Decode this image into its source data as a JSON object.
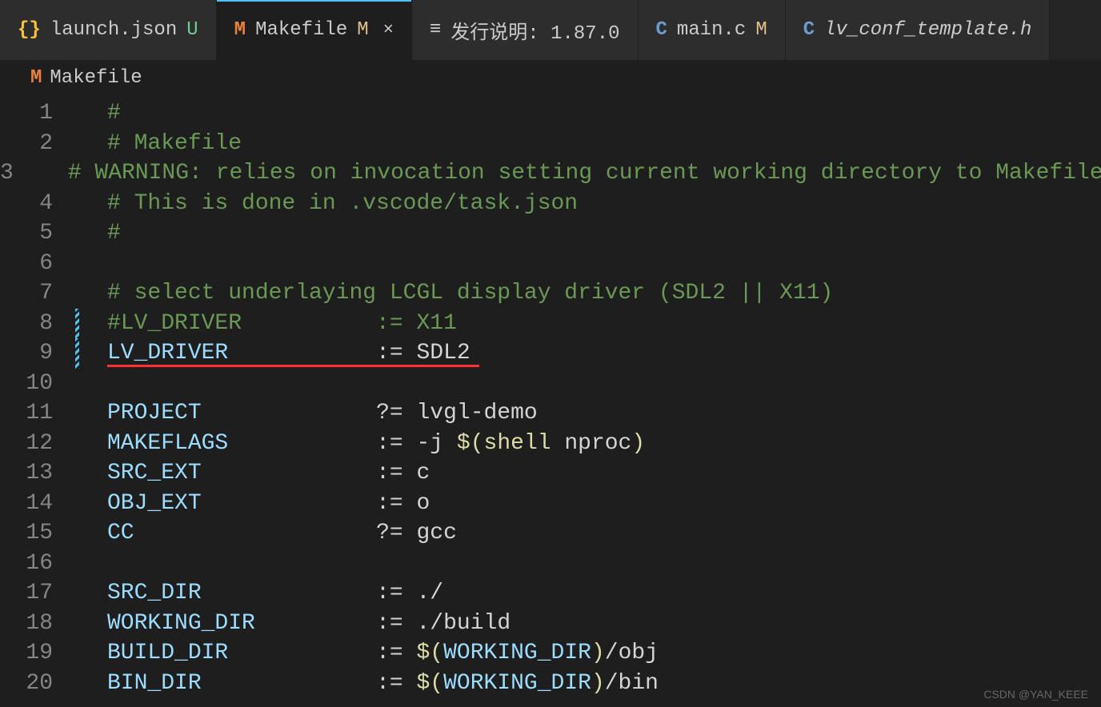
{
  "tabs": [
    {
      "icon": "{}",
      "iconClass": "icon-json",
      "label": "launch.json",
      "status": "U",
      "statusClass": "status-untracked",
      "active": false,
      "italic": false,
      "close": false
    },
    {
      "icon": "M",
      "iconClass": "icon-makefile",
      "label": "Makefile",
      "status": "M",
      "statusClass": "status-modified",
      "active": true,
      "italic": false,
      "close": true
    },
    {
      "icon": "≡",
      "iconClass": "icon-notes",
      "label": "发行说明: 1.87.0",
      "status": "",
      "statusClass": "",
      "active": false,
      "italic": false,
      "close": false
    },
    {
      "icon": "C",
      "iconClass": "icon-c",
      "label": "main.c",
      "status": "M",
      "statusClass": "status-modified",
      "active": false,
      "italic": false,
      "close": false
    },
    {
      "icon": "C",
      "iconClass": "icon-c",
      "label": "lv_conf_template.h",
      "status": "",
      "statusClass": "",
      "active": false,
      "italic": true,
      "close": false
    }
  ],
  "breadcrumb": {
    "icon": "M",
    "label": "Makefile"
  },
  "code": {
    "lines": [
      {
        "n": 1,
        "marker": "",
        "tokens": [
          {
            "c": "tok-comment",
            "t": "#"
          }
        ]
      },
      {
        "n": 2,
        "marker": "",
        "tokens": [
          {
            "c": "tok-comment",
            "t": "# Makefile"
          }
        ]
      },
      {
        "n": 3,
        "marker": "",
        "tokens": [
          {
            "c": "tok-comment",
            "t": "# WARNING: relies on invocation setting current working directory to Makefile lo"
          }
        ]
      },
      {
        "n": 4,
        "marker": "",
        "tokens": [
          {
            "c": "tok-comment",
            "t": "# This is done in .vscode/task.json"
          }
        ]
      },
      {
        "n": 5,
        "marker": "",
        "tokens": [
          {
            "c": "tok-comment",
            "t": "#"
          }
        ]
      },
      {
        "n": 6,
        "marker": "",
        "tokens": []
      },
      {
        "n": 7,
        "marker": "",
        "tokens": [
          {
            "c": "tok-comment",
            "t": "# select underlaying LCGL display driver (SDL2 || X11)"
          }
        ]
      },
      {
        "n": 8,
        "marker": "modified",
        "tokens": [
          {
            "c": "tok-comment",
            "t": "#LV_DRIVER          := X11"
          }
        ]
      },
      {
        "n": 9,
        "marker": "modified",
        "underline": true,
        "tokens": [
          {
            "c": "tok-var",
            "t": "LV_DRIVER"
          },
          {
            "c": "",
            "t": "           "
          },
          {
            "c": "tok-op",
            "t": ":="
          },
          {
            "c": "",
            "t": " "
          },
          {
            "c": "tok-txt",
            "t": "SDL2"
          }
        ]
      },
      {
        "n": 10,
        "marker": "",
        "tokens": []
      },
      {
        "n": 11,
        "marker": "",
        "tokens": [
          {
            "c": "tok-var",
            "t": "PROJECT"
          },
          {
            "c": "",
            "t": "             "
          },
          {
            "c": "tok-op",
            "t": "?="
          },
          {
            "c": "",
            "t": " "
          },
          {
            "c": "tok-txt",
            "t": "lvgl-demo"
          }
        ]
      },
      {
        "n": 12,
        "marker": "",
        "tokens": [
          {
            "c": "tok-var",
            "t": "MAKEFLAGS"
          },
          {
            "c": "",
            "t": "           "
          },
          {
            "c": "tok-op",
            "t": ":="
          },
          {
            "c": "",
            "t": " "
          },
          {
            "c": "tok-txt",
            "t": "-j "
          },
          {
            "c": "tok-yellow",
            "t": "$("
          },
          {
            "c": "tok-func",
            "t": "shell"
          },
          {
            "c": "tok-txt",
            "t": " nproc"
          },
          {
            "c": "tok-yellow",
            "t": ")"
          }
        ]
      },
      {
        "n": 13,
        "marker": "",
        "tokens": [
          {
            "c": "tok-var",
            "t": "SRC_EXT"
          },
          {
            "c": "",
            "t": "             "
          },
          {
            "c": "tok-op",
            "t": ":="
          },
          {
            "c": "",
            "t": " "
          },
          {
            "c": "tok-txt",
            "t": "c"
          }
        ]
      },
      {
        "n": 14,
        "marker": "",
        "tokens": [
          {
            "c": "tok-var",
            "t": "OBJ_EXT"
          },
          {
            "c": "",
            "t": "             "
          },
          {
            "c": "tok-op",
            "t": ":="
          },
          {
            "c": "",
            "t": " "
          },
          {
            "c": "tok-txt",
            "t": "o"
          }
        ]
      },
      {
        "n": 15,
        "marker": "",
        "tokens": [
          {
            "c": "tok-var",
            "t": "CC"
          },
          {
            "c": "",
            "t": "                  "
          },
          {
            "c": "tok-op",
            "t": "?="
          },
          {
            "c": "",
            "t": " "
          },
          {
            "c": "tok-txt",
            "t": "gcc"
          }
        ]
      },
      {
        "n": 16,
        "marker": "",
        "tokens": []
      },
      {
        "n": 17,
        "marker": "",
        "tokens": [
          {
            "c": "tok-var",
            "t": "SRC_DIR"
          },
          {
            "c": "",
            "t": "             "
          },
          {
            "c": "tok-op",
            "t": ":="
          },
          {
            "c": "",
            "t": " "
          },
          {
            "c": "tok-txt",
            "t": "./"
          }
        ]
      },
      {
        "n": 18,
        "marker": "",
        "tokens": [
          {
            "c": "tok-var",
            "t": "WORKING_DIR"
          },
          {
            "c": "",
            "t": "         "
          },
          {
            "c": "tok-op",
            "t": ":="
          },
          {
            "c": "",
            "t": " "
          },
          {
            "c": "tok-txt",
            "t": "./build"
          }
        ]
      },
      {
        "n": 19,
        "marker": "",
        "tokens": [
          {
            "c": "tok-var",
            "t": "BUILD_DIR"
          },
          {
            "c": "",
            "t": "           "
          },
          {
            "c": "tok-op",
            "t": ":="
          },
          {
            "c": "",
            "t": " "
          },
          {
            "c": "tok-yellow",
            "t": "$("
          },
          {
            "c": "tok-var",
            "t": "WORKING_DIR"
          },
          {
            "c": "tok-yellow",
            "t": ")"
          },
          {
            "c": "tok-txt",
            "t": "/obj"
          }
        ]
      },
      {
        "n": 20,
        "marker": "",
        "tokens": [
          {
            "c": "tok-var",
            "t": "BIN_DIR"
          },
          {
            "c": "",
            "t": "             "
          },
          {
            "c": "tok-op",
            "t": ":="
          },
          {
            "c": "",
            "t": " "
          },
          {
            "c": "tok-yellow",
            "t": "$("
          },
          {
            "c": "tok-var",
            "t": "WORKING_DIR"
          },
          {
            "c": "tok-yellow",
            "t": ")"
          },
          {
            "c": "tok-txt",
            "t": "/bin"
          }
        ]
      }
    ]
  },
  "watermark": "CSDN @YAN_KEEE"
}
